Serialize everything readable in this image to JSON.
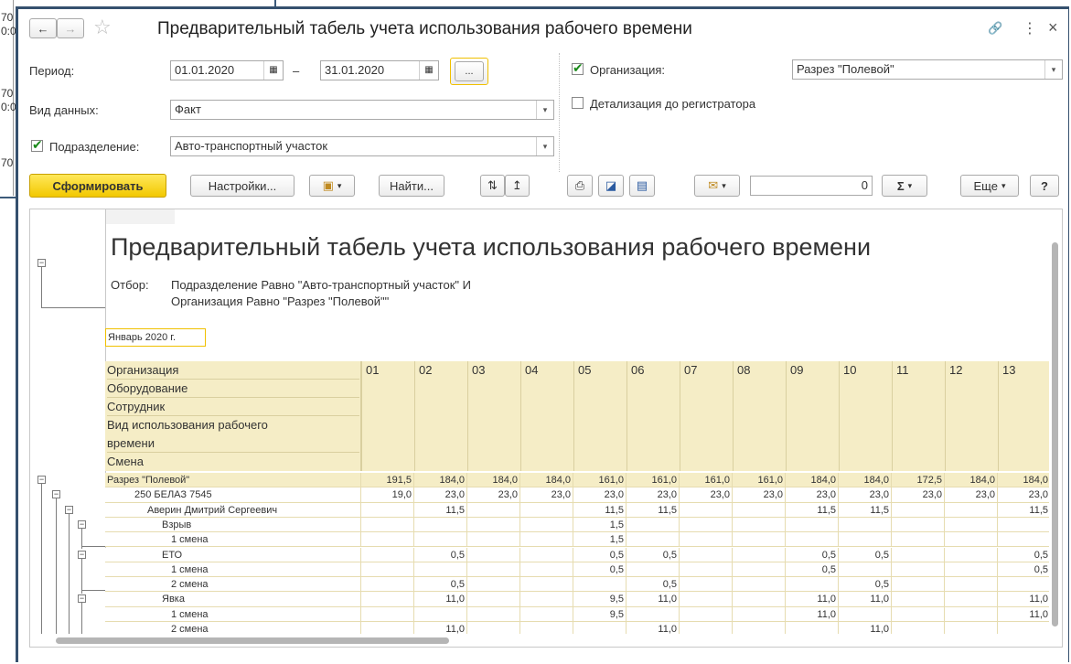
{
  "background_window": {
    "fragments": [
      "70",
      "0:0",
      "70",
      "0:0",
      "70"
    ]
  },
  "window": {
    "title": "Предварительный табель учета использования рабочего времени",
    "back_icon": "←",
    "forward_icon": "→",
    "star_icon": "☆",
    "link_icon": "🔗",
    "menu_icon": "⋮",
    "close_icon": "×"
  },
  "form": {
    "period_label": "Период:",
    "date_from": "01.01.2020",
    "dash": "–",
    "date_to": "31.01.2020",
    "period_btn": "...",
    "org_label": "Организация:",
    "org_value": "Разрез \"Полевой\"",
    "detail_label": "Детализация до регистратора",
    "vid_label": "Вид данных:",
    "vid_value": "Факт",
    "dept_label": "Подразделение:",
    "dept_value": "Авто-транспортный участок"
  },
  "toolbar": {
    "generate": "Сформировать",
    "settings": "Настройки...",
    "find": "Найти...",
    "number_value": "0",
    "sum": "Σ",
    "more": "Еще",
    "help": "?"
  },
  "report": {
    "title": "Предварительный табель учета использования рабочего времени",
    "filter_label": "Отбор:",
    "filter_line1": "Подразделение Равно \"Авто-транспортный участок\" И",
    "filter_line2": "Организация Равно \"Разрез \"Полевой\"\"",
    "month": "Январь 2020 г.",
    "header_rows": [
      "Организация",
      "Оборудование",
      "Сотрудник",
      "Вид использования рабочего",
      "времени",
      "Смена"
    ],
    "days": [
      "01",
      "02",
      "03",
      "04",
      "05",
      "06",
      "07",
      "08",
      "09",
      "10",
      "11",
      "12",
      "13"
    ],
    "rows": [
      {
        "label": "Разрез \"Полевой\"",
        "indent": 0,
        "values": [
          "191,5",
          "184,0",
          "184,0",
          "184,0",
          "161,0",
          "161,0",
          "161,0",
          "161,0",
          "184,0",
          "184,0",
          "172,5",
          "184,0",
          "184,0"
        ]
      },
      {
        "label": "250 БЕЛАЗ 7545",
        "indent": 1,
        "values": [
          "19,0",
          "23,0",
          "23,0",
          "23,0",
          "23,0",
          "23,0",
          "23,0",
          "23,0",
          "23,0",
          "23,0",
          "23,0",
          "23,0",
          "23,0"
        ]
      },
      {
        "label": "Аверин Дмитрий Сергеевич",
        "indent": 2,
        "values": [
          "",
          "11,5",
          "",
          "",
          "11,5",
          "11,5",
          "",
          "",
          "11,5",
          "11,5",
          "",
          "",
          "11,5"
        ]
      },
      {
        "label": "Взрыв",
        "indent": 3,
        "values": [
          "",
          "",
          "",
          "",
          "1,5",
          "",
          "",
          "",
          "",
          "",
          "",
          "",
          ""
        ]
      },
      {
        "label": "1 смена",
        "indent": 4,
        "values": [
          "",
          "",
          "",
          "",
          "1,5",
          "",
          "",
          "",
          "",
          "",
          "",
          "",
          ""
        ]
      },
      {
        "label": "ЕТО",
        "indent": 3,
        "values": [
          "",
          "0,5",
          "",
          "",
          "0,5",
          "0,5",
          "",
          "",
          "0,5",
          "0,5",
          "",
          "",
          "0,5"
        ]
      },
      {
        "label": "1 смена",
        "indent": 4,
        "values": [
          "",
          "",
          "",
          "",
          "0,5",
          "",
          "",
          "",
          "0,5",
          "",
          "",
          "",
          "0,5"
        ]
      },
      {
        "label": "2 смена",
        "indent": 4,
        "values": [
          "",
          "0,5",
          "",
          "",
          "",
          "0,5",
          "",
          "",
          "",
          "0,5",
          "",
          "",
          ""
        ]
      },
      {
        "label": "Явка",
        "indent": 3,
        "values": [
          "",
          "11,0",
          "",
          "",
          "9,5",
          "11,0",
          "",
          "",
          "11,0",
          "11,0",
          "",
          "",
          "11,0"
        ]
      },
      {
        "label": "1 смена",
        "indent": 4,
        "values": [
          "",
          "",
          "",
          "",
          "9,5",
          "",
          "",
          "",
          "11,0",
          "",
          "",
          "",
          "11,0"
        ]
      },
      {
        "label": "2 смена",
        "indent": 4,
        "values": [
          "",
          "11,0",
          "",
          "",
          "",
          "11,0",
          "",
          "",
          "",
          "11,0",
          "",
          "",
          ""
        ]
      }
    ]
  }
}
